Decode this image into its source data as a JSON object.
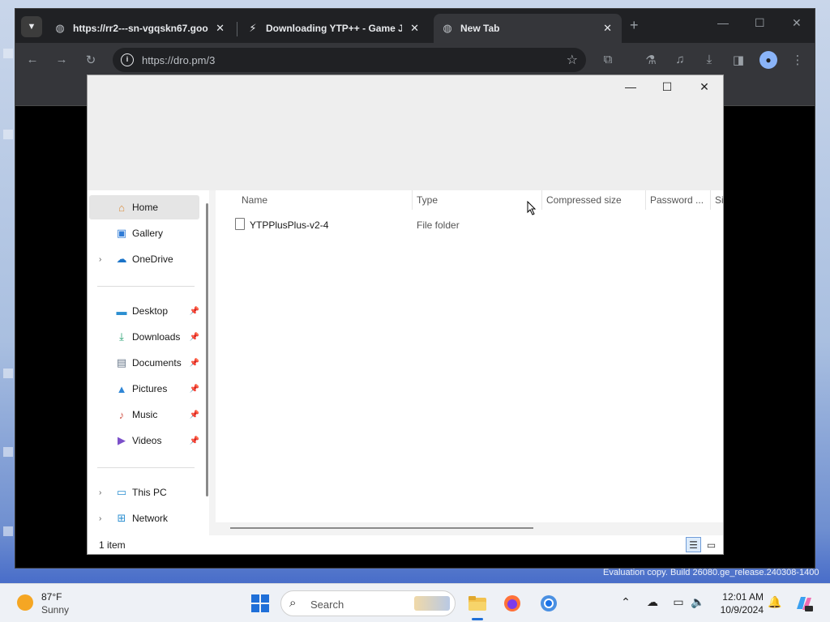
{
  "browser": {
    "tabs": [
      {
        "title": "https://rr2---sn-vgqskn67.goo",
        "icon": "globe-icon"
      },
      {
        "title": "Downloading YTP++ - Game J",
        "icon": "lightning-icon"
      },
      {
        "title": "New Tab",
        "icon": "globe-icon"
      }
    ],
    "address": "https://dro.pm/3"
  },
  "explorer": {
    "nav": {
      "home": "Home",
      "gallery": "Gallery",
      "onedrive": "OneDrive",
      "desktop": "Desktop",
      "downloads": "Downloads",
      "documents": "Documents",
      "pictures": "Pictures",
      "music": "Music",
      "videos": "Videos",
      "thispc": "This PC",
      "network": "Network"
    },
    "columns": {
      "name": "Name",
      "type": "Type",
      "compressed": "Compressed size",
      "password": "Password ...",
      "size": "Si"
    },
    "rows": [
      {
        "name": "YTPPlusPlus-v2-4",
        "type": "File folder"
      }
    ],
    "status": "1 item"
  },
  "watermark": "Evaluation copy. Build 26080.ge_release.240308-1400",
  "taskbar": {
    "temperature": "87°F",
    "condition": "Sunny",
    "search": "Search",
    "time": "12:01 AM",
    "date": "10/9/2024"
  },
  "colors": {
    "accent": "#1f6fd8",
    "tabstrip": "#202124",
    "toolbar": "#35363a"
  }
}
